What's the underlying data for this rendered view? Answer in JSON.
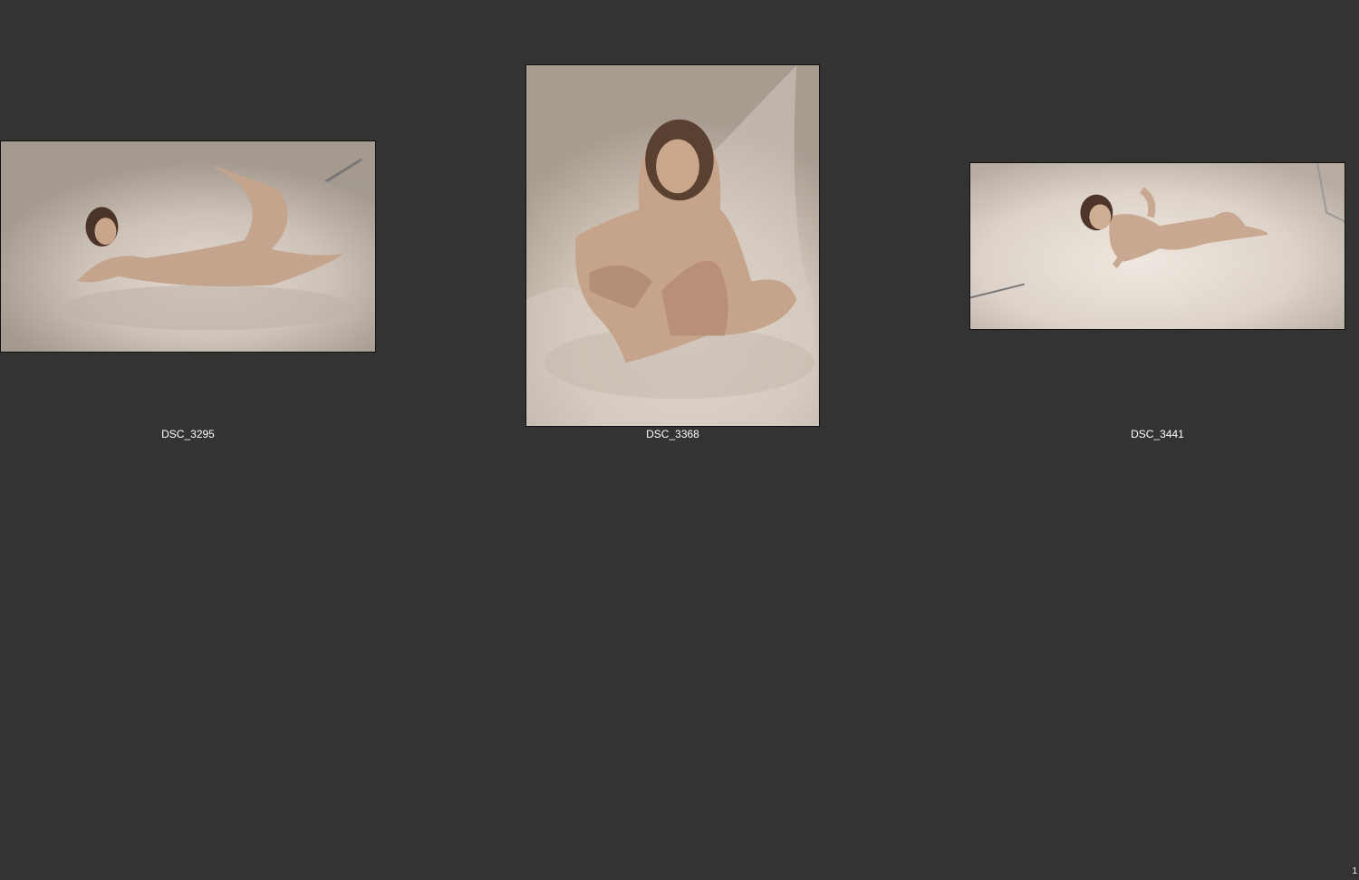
{
  "sheet": {
    "background_color": "#333333",
    "page_number": "1"
  },
  "thumbnails": [
    {
      "caption": "DSC_3295"
    },
    {
      "caption": "DSC_3368"
    },
    {
      "caption": "DSC_3441"
    }
  ]
}
